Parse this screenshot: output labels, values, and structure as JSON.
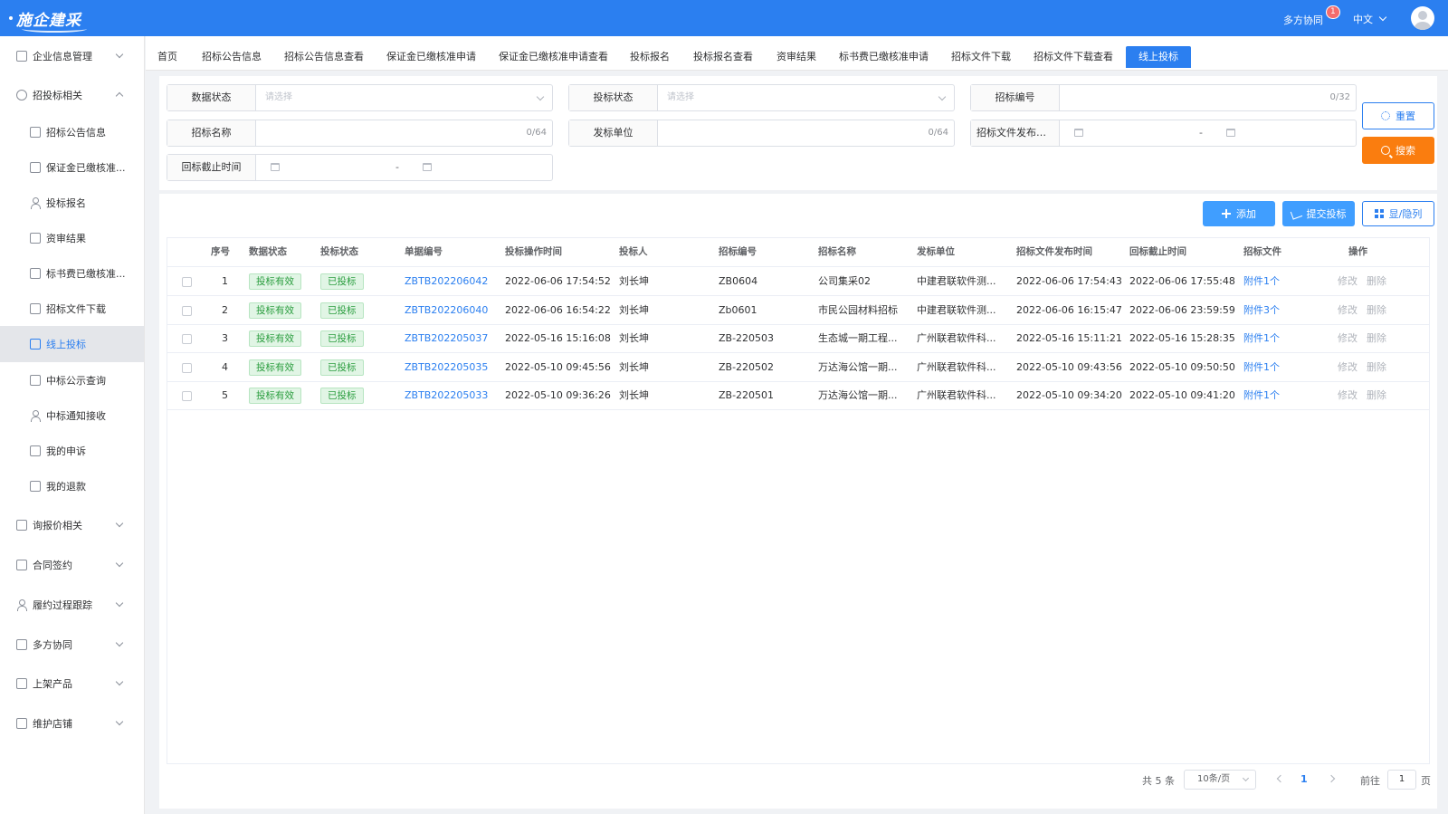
{
  "header": {
    "logo_text": "施企建采",
    "collab_label": "多方协同",
    "notification_count": "1",
    "language": "中文"
  },
  "sidebar": {
    "items": [
      {
        "label": "企业信息管理",
        "level": "top",
        "icon": "building-icon"
      },
      {
        "label": "招投标相关",
        "level": "top",
        "icon": "gavel-icon"
      },
      {
        "label": "招标公告信息",
        "level": "sub",
        "icon": "document-icon"
      },
      {
        "label": "保证金已缴核准...",
        "level": "sub",
        "icon": "clipboard-icon"
      },
      {
        "label": "投标报名",
        "level": "sub",
        "icon": "person-icon"
      },
      {
        "label": "资审结果",
        "level": "sub",
        "icon": "checklist-icon"
      },
      {
        "label": "标书费已缴核准...",
        "level": "sub",
        "icon": "document-icon"
      },
      {
        "label": "招标文件下载",
        "level": "sub",
        "icon": "hierarchy-icon"
      },
      {
        "label": "线上投标",
        "level": "sub",
        "icon": "document-icon",
        "active": true
      },
      {
        "label": "中标公示查询",
        "level": "sub",
        "icon": "list-icon"
      },
      {
        "label": "中标通知接收",
        "level": "sub",
        "icon": "person-icon"
      },
      {
        "label": "我的申诉",
        "level": "sub",
        "icon": "document-icon"
      },
      {
        "label": "我的退款",
        "level": "sub",
        "icon": "database-icon"
      },
      {
        "label": "询报价相关",
        "level": "top",
        "icon": "quote-icon"
      },
      {
        "label": "合同签约",
        "level": "top",
        "icon": "contract-icon"
      },
      {
        "label": "履约过程跟踪",
        "level": "top",
        "icon": "person-icon"
      },
      {
        "label": "多方协同",
        "level": "top",
        "icon": "collab-icon"
      },
      {
        "label": "上架产品",
        "level": "top",
        "icon": "product-icon"
      },
      {
        "label": "维护店铺",
        "level": "top",
        "icon": "shop-icon"
      }
    ]
  },
  "tabs": [
    "首页",
    "招标公告信息",
    "招标公告信息查看",
    "保证金已缴核准申请",
    "保证金已缴核准申请查看",
    "投标报名",
    "投标报名查看",
    "资审结果",
    "标书费已缴核准申请",
    "招标文件下载",
    "招标文件下载查看",
    "线上投标"
  ],
  "filters": {
    "data_status": {
      "label": "数据状态",
      "placeholder": "请选择"
    },
    "bid_status": {
      "label": "投标状态",
      "placeholder": "请选择"
    },
    "tender_no": {
      "label": "招标编号",
      "counter": "0/32"
    },
    "tender_name": {
      "label": "招标名称",
      "counter": "0/64"
    },
    "issuer": {
      "label": "发标单位",
      "counter": "0/64"
    },
    "publish_time": {
      "label": "招标文件发布时...",
      "separator": "-"
    },
    "deadline": {
      "label": "回标截止时间",
      "separator": "-"
    },
    "reset_label": "重置",
    "search_label": "搜索"
  },
  "toolbar": {
    "add_label": "添加",
    "submit_label": "提交投标",
    "columns_label": "显/隐列"
  },
  "table": {
    "headers": [
      "序号",
      "数据状态",
      "投标状态",
      "单据编号",
      "投标操作时间",
      "投标人",
      "招标编号",
      "招标名称",
      "发标单位",
      "招标文件发布时间",
      "回标截止时间",
      "招标文件",
      "操作"
    ],
    "rows": [
      {
        "no": "1",
        "data_status": "投标有效",
        "bid_status": "已投标",
        "doc_no": "ZBTB202206042",
        "op_time": "2022-06-06 17:54:52",
        "bidder": "刘长坤",
        "tender_no": "ZB0604",
        "tender_name": "公司集采02",
        "issuer": "中建君联软件测...",
        "publish_time": "2022-06-06 17:54:43",
        "deadline": "2022-06-06 17:55:48",
        "attachment": "附件1个",
        "edit": "修改",
        "delete": "删除"
      },
      {
        "no": "2",
        "data_status": "投标有效",
        "bid_status": "已投标",
        "doc_no": "ZBTB202206040",
        "op_time": "2022-06-06 16:54:22",
        "bidder": "刘长坤",
        "tender_no": "Zb0601",
        "tender_name": "市民公园材料招标",
        "issuer": "中建君联软件测...",
        "publish_time": "2022-06-06 16:15:47",
        "deadline": "2022-06-06 23:59:59",
        "attachment": "附件3个",
        "edit": "修改",
        "delete": "删除"
      },
      {
        "no": "3",
        "data_status": "投标有效",
        "bid_status": "已投标",
        "doc_no": "ZBTB202205037",
        "op_time": "2022-05-16 15:16:08",
        "bidder": "刘长坤",
        "tender_no": "ZB-220503",
        "tender_name": "生态城一期工程...",
        "issuer": "广州联君软件科...",
        "publish_time": "2022-05-16 15:11:21",
        "deadline": "2022-05-16 15:28:35",
        "attachment": "附件1个",
        "edit": "修改",
        "delete": "删除"
      },
      {
        "no": "4",
        "data_status": "投标有效",
        "bid_status": "已投标",
        "doc_no": "ZBTB202205035",
        "op_time": "2022-05-10 09:45:56",
        "bidder": "刘长坤",
        "tender_no": "ZB-220502",
        "tender_name": "万达海公馆一期...",
        "issuer": "广州联君软件科...",
        "publish_time": "2022-05-10 09:43:56",
        "deadline": "2022-05-10 09:50:50",
        "attachment": "附件1个",
        "edit": "修改",
        "delete": "删除"
      },
      {
        "no": "5",
        "data_status": "投标有效",
        "bid_status": "已投标",
        "doc_no": "ZBTB202205033",
        "op_time": "2022-05-10 09:36:26",
        "bidder": "刘长坤",
        "tender_no": "ZB-220501",
        "tender_name": "万达海公馆一期...",
        "issuer": "广州联君软件科...",
        "publish_time": "2022-05-10 09:34:20",
        "deadline": "2022-05-10 09:41:20",
        "attachment": "附件1个",
        "edit": "修改",
        "delete": "删除"
      }
    ]
  },
  "pagination": {
    "total": "共 5 条",
    "page_size": "10条/页",
    "current": "1",
    "goto_label": "前往",
    "goto_value": "1",
    "page_suffix": "页"
  },
  "colors": {
    "brand": "#2b7ff0",
    "search_button": "#fa7d0f",
    "tag_green": "#2a9d3e"
  }
}
